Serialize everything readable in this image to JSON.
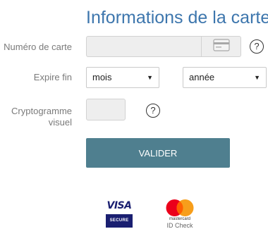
{
  "form": {
    "title": "Informations de la carte",
    "card_number": {
      "label": "Numéro de carte",
      "value": "",
      "help": "?"
    },
    "expiry": {
      "label": "Expire fin",
      "month": {
        "selected": "mois"
      },
      "year": {
        "selected": "année"
      }
    },
    "cvv": {
      "label_line1": "Cryptogramme",
      "label_line2": "visuel",
      "value": "",
      "help": "?"
    },
    "submit_label": "VALIDER"
  },
  "badges": {
    "visa": {
      "brand": "VISA",
      "tagline": "SECURE"
    },
    "mastercard": {
      "wordmark": "mastercard",
      "tagline": "ID Check"
    }
  },
  "colors": {
    "title": "#3d76ad",
    "label": "#7a7a7a",
    "button": "#4f7f8f",
    "visa_blue": "#1a1f71",
    "mc_red": "#eb001b",
    "mc_orange": "#f79e1b",
    "mc_overlap": "#ff5f00"
  }
}
